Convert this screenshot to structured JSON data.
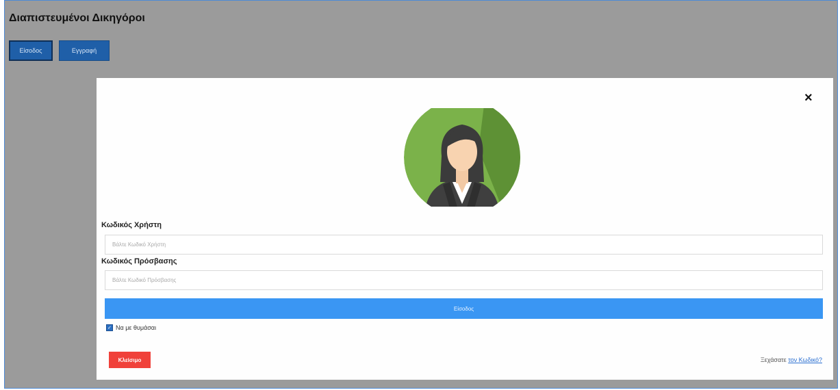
{
  "header": {
    "title": "Διαπιστευμένοι Δικηγόροι",
    "buttons": [
      {
        "label": "Είσοδος"
      },
      {
        "label": "Εγγραφή"
      }
    ]
  },
  "modal": {
    "close_glyph": "×",
    "username": {
      "label": "Κωδικός Χρήστη",
      "placeholder": "Βάλτε Κωδικό Χρήστη"
    },
    "password": {
      "label": "Κωδικός Πρόσβασης",
      "placeholder": "Βάλτε Κωδικό Πρόσβασης"
    },
    "login_label": "Είσοδος",
    "remember": {
      "label": "Να με θυμάσαι",
      "checked": true
    },
    "cancel_label": "Κλείσιμο",
    "forgot": {
      "prefix": "Ξεχάσατε ",
      "link": "τον Κωδικό?"
    }
  },
  "colors": {
    "backdrop": "#9b9b9b",
    "primary": "#3a96f3",
    "top_button": "#1f5fa8",
    "cancel": "#f0413a",
    "avatar_green": "#7bb24a"
  },
  "icons": {
    "avatar": "user-avatar-woman",
    "close": "close-icon",
    "checkbox": "checkmark"
  }
}
